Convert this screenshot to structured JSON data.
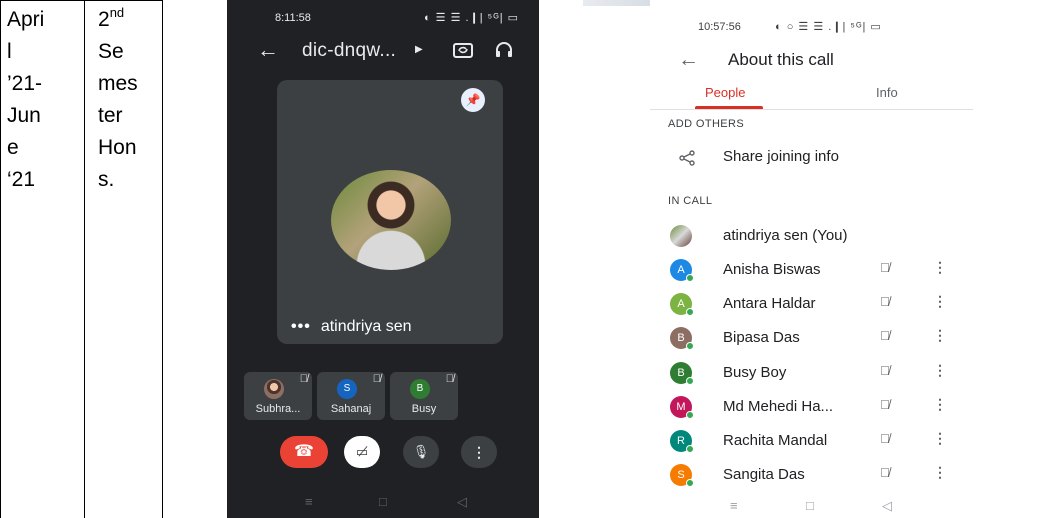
{
  "document": {
    "period": [
      "Apri",
      "l",
      "’21-",
      "Jun",
      "e",
      "‘21"
    ],
    "semester_ordinal": "2",
    "semester_suffix": "nd",
    "semester_rest": [
      "Se",
      "mes",
      "ter",
      "Hon",
      "s."
    ]
  },
  "meet_call": {
    "status_time": "8:11:58",
    "status_icons": "◐ ☰ ☰ .❙| ⁵ᴳ| ▭",
    "meeting_code": "dic-dnqw...",
    "main_participant": "atindriya sen",
    "thumbnails": [
      {
        "initial": "",
        "label": "Subhra...",
        "color": "#8d6e63"
      },
      {
        "initial": "S",
        "label": "Sahanaj",
        "color": "#1565c0"
      },
      {
        "initial": "B",
        "label": "Busy",
        "color": "#2e7d32"
      }
    ],
    "colors": {
      "background": "#202124",
      "end_call": "#ea4335"
    }
  },
  "about_call": {
    "status_time": "10:57:56",
    "status_icons": "◐ ○ ☰ ☰ .❙| ⁵ᴳ| ▭",
    "title": "About this call",
    "tabs": [
      "People",
      "Info"
    ],
    "add_others_label": "ADD OTHERS",
    "share_label": "Share joining info",
    "in_call_label": "IN CALL",
    "you": "atindriya sen (You)",
    "participants": [
      {
        "initial": "A",
        "name": "Anisha Biswas",
        "color": "#1e88e5"
      },
      {
        "initial": "A",
        "name": "Antara Haldar",
        "color": "#7cb342"
      },
      {
        "initial": "B",
        "name": "Bipasa Das",
        "color": "#8d6e63"
      },
      {
        "initial": "B",
        "name": "Busy Boy",
        "color": "#2e7d32"
      },
      {
        "initial": "M",
        "name": "Md Mehedi Ha...",
        "color": "#c2185b"
      },
      {
        "initial": "R",
        "name": "Rachita Mandal",
        "color": "#00897b"
      },
      {
        "initial": "S",
        "name": "Sangita Das",
        "color": "#f57c00"
      }
    ],
    "colors": {
      "accent": "#d93025"
    }
  }
}
